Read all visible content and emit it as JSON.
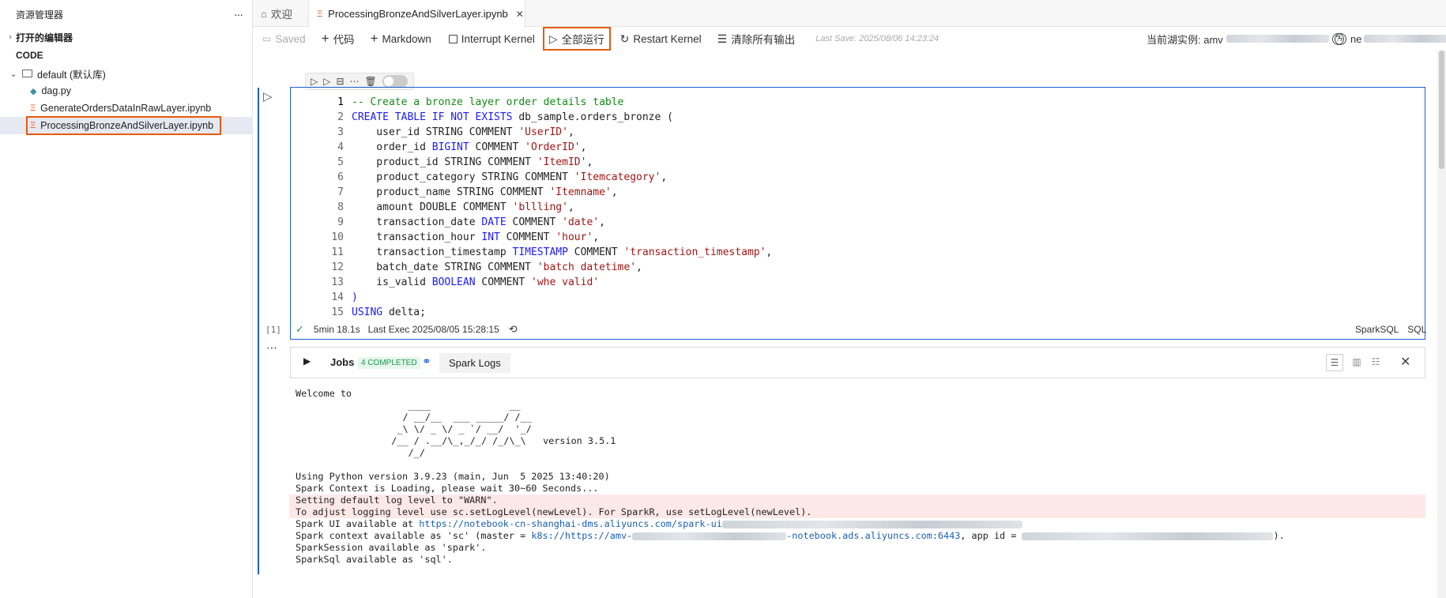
{
  "sidebar": {
    "title": "资源管理器",
    "more": "···",
    "open_editors": "打开的编辑器",
    "section": "CODE",
    "folder": "default (默认库)",
    "files": [
      "dag.py",
      "GenerateOrdersDataInRawLayer.ipynb",
      "ProcessingBronzeAndSilverLayer.ipynb"
    ]
  },
  "tabs": [
    {
      "label": "欢迎"
    },
    {
      "label": "ProcessingBronzeAndSilverLayer.ipynb",
      "close": "✕"
    }
  ],
  "toolbar": {
    "saved": "Saved",
    "code": "代码",
    "markdown": "Markdown",
    "interrupt": "Interrupt Kernel",
    "run_all": "全部运行",
    "restart": "Restart Kernel",
    "clear": "清除所有输出",
    "last_save": "Last Save: 2025/08/06 14:23:24",
    "instance_label": "当前湖实例: amv",
    "kernel_prefix": "ne"
  },
  "cell": {
    "exec_count": "[1]",
    "lines": [
      [
        [
          "cm",
          "-- Create a bronze layer order details table"
        ]
      ],
      [
        [
          "kw",
          "CREATE TABLE "
        ],
        [
          "kw",
          "IF NOT EXISTS"
        ],
        [
          "p",
          " db_sample.orders_bronze ("
        ]
      ],
      [
        [
          "p",
          "    user_id STRING COMMENT "
        ],
        [
          "str",
          "'UserID'"
        ],
        [
          "p",
          ","
        ]
      ],
      [
        [
          "p",
          "    order_id "
        ],
        [
          "kw",
          "BIGINT"
        ],
        [
          "p",
          " COMMENT "
        ],
        [
          "str",
          "'OrderID'"
        ],
        [
          "p",
          ","
        ]
      ],
      [
        [
          "p",
          "    product_id STRING COMMENT "
        ],
        [
          "str",
          "'ItemID'"
        ],
        [
          "p",
          ","
        ]
      ],
      [
        [
          "p",
          "    product_category STRING COMMENT "
        ],
        [
          "str",
          "'Itemcategory'"
        ],
        [
          "p",
          ","
        ]
      ],
      [
        [
          "p",
          "    product_name STRING COMMENT "
        ],
        [
          "str",
          "'Itemname'"
        ],
        [
          "p",
          ","
        ]
      ],
      [
        [
          "p",
          "    amount DOUBLE COMMENT "
        ],
        [
          "str",
          "'bllling'"
        ],
        [
          "p",
          ","
        ]
      ],
      [
        [
          "p",
          "    transaction_date "
        ],
        [
          "kw",
          "DATE"
        ],
        [
          "p",
          " COMMENT "
        ],
        [
          "str",
          "'date'"
        ],
        [
          "p",
          ","
        ]
      ],
      [
        [
          "p",
          "    transaction_hour "
        ],
        [
          "kw",
          "INT"
        ],
        [
          "p",
          " COMMENT "
        ],
        [
          "str",
          "'hour'"
        ],
        [
          "p",
          ","
        ]
      ],
      [
        [
          "p",
          "    transaction_timestamp "
        ],
        [
          "kw",
          "TIMESTAMP"
        ],
        [
          "p",
          " COMMENT "
        ],
        [
          "str",
          "'transaction_timestamp'"
        ],
        [
          "p",
          ","
        ]
      ],
      [
        [
          "p",
          "    batch_date STRING COMMENT "
        ],
        [
          "str",
          "'batch datetime'"
        ],
        [
          "p",
          ","
        ]
      ],
      [
        [
          "p",
          "    is_valid "
        ],
        [
          "kw",
          "BOOLEAN"
        ],
        [
          "p",
          " COMMENT "
        ],
        [
          "str",
          "'whe valid'"
        ]
      ],
      [
        [
          "kw",
          ")"
        ]
      ],
      [
        [
          "kw",
          "USING"
        ],
        [
          "p",
          " delta;"
        ]
      ]
    ],
    "status_duration": "5min 18.1s",
    "status_last_exec": "Last Exec 2025/08/05 15:28:15",
    "lang1": "SparkSQL",
    "lang2": "SQL"
  },
  "jobs_panel": {
    "jobs": "Jobs",
    "completed": "4 COMPLETED",
    "spark_logs": "Spark Logs",
    "close": "✕"
  },
  "output": {
    "welcome": "Welcome to",
    "logo": [
      "      ____              __",
      "     / __/__  ___ _____/ /__",
      "    _\\ \\/ _ \\/ _ `/ __/  '_/",
      "   /__ / .__/\\_,_/_/ /_/\\_\\   version 3.5.1",
      "      /_/"
    ],
    "python": "Using Python version 3.9.23 (main, Jun  5 2025 13:40:20)",
    "loading": "Spark Context is Loading, please wait 30~60 Seconds...",
    "warn1": "Setting default log level to \"WARN\".",
    "warn2": "To adjust logging level use sc.setLogLevel(newLevel). For SparkR, use setLogLevel(newLevel).",
    "ui_prefix": "Spark UI available at ",
    "ui_link": "https://notebook-cn-shanghai-dms.aliyuncs.com/spark-ui",
    "ctx_prefix": "Spark context available as 'sc' (master = ",
    "ctx_link1": "k8s://https://amv-",
    "ctx_link2": "-notebook.ads.aliyuncs.com:6443",
    "ctx_mid": ", app id = ",
    "ctx_end": ").",
    "session": "SparkSession available as 'spark'.",
    "sql": "SparkSql available as 'sql'."
  },
  "colors": {
    "accent": "#e8590c",
    "cell_border": "#1f5fd1",
    "warn_bg": "#fde8e8",
    "badge_bg": "#e6f6ec",
    "badge_fg": "#1a9a4a"
  }
}
